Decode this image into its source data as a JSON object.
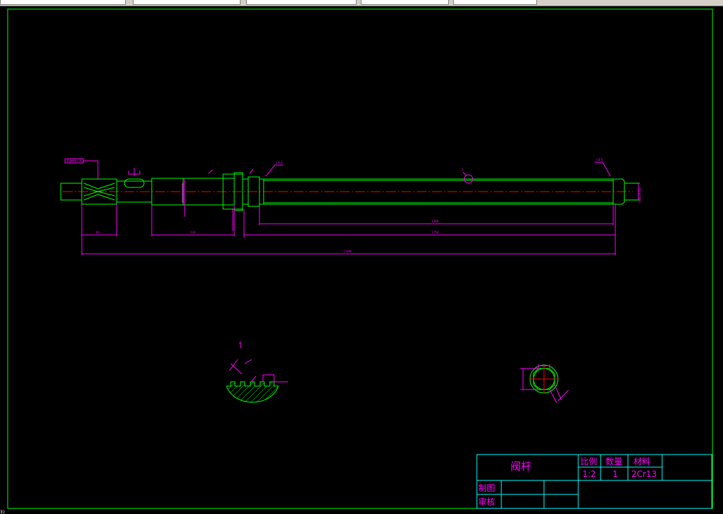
{
  "toolbar": {
    "segments": 6
  },
  "status": {
    "corner_text": "ﾖｼ"
  },
  "colors": {
    "border": "#00ff00",
    "part": "#00ff00",
    "dim": "#ff00ff",
    "centerline": "#ff0000",
    "aux": "#00ffff",
    "title_text": "#ff00ff",
    "title_lines": "#00ffff"
  },
  "title_block": {
    "part_name": "阀杆",
    "scale_label": "比例",
    "qty_label": "数量",
    "material_label": "材料",
    "scale_value": "1:2",
    "qty_value": "1",
    "material_value": "2Cr13",
    "drawn_by_label": "制图",
    "checked_by_label": "审核"
  },
  "dimensions": {
    "overall_length": "1596",
    "thread_length": "1389",
    "long_span": "1758",
    "mid_length": "230",
    "left_length": "60",
    "chamfer_left": "C0.5",
    "chamfer_right": "C0.5",
    "thread_spec": "Tr28×5-7e",
    "spline_callout": "花键M6×28",
    "balloon": "3"
  }
}
